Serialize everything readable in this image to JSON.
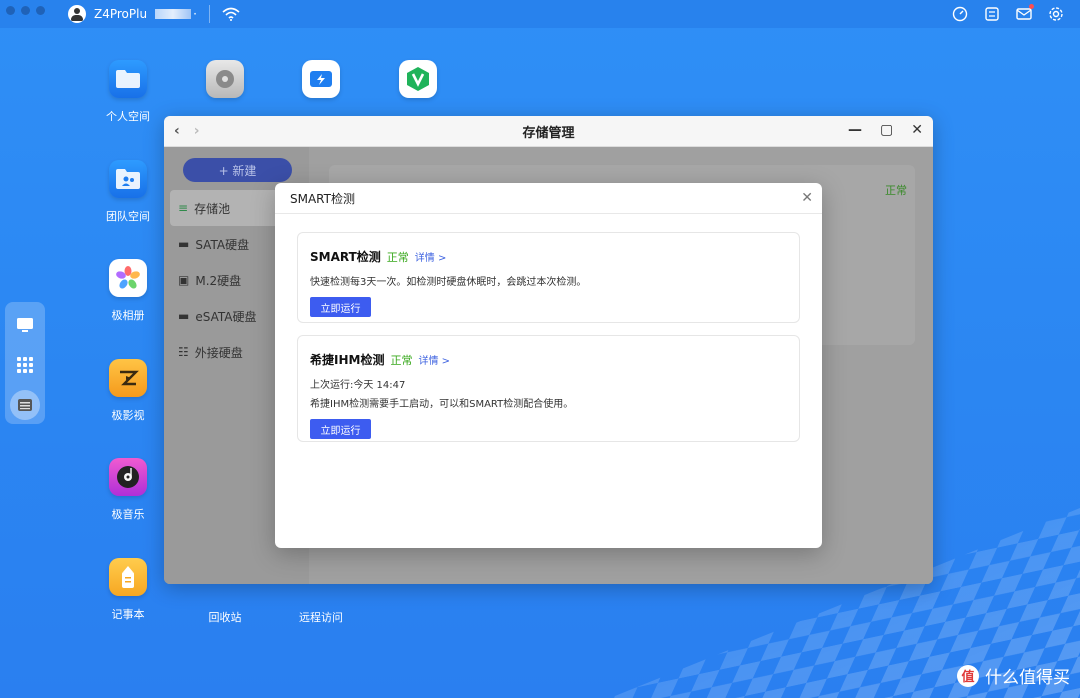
{
  "topbar": {
    "device_name": "Z4ProPlu",
    "device_suffix": "·"
  },
  "desktop": {
    "icons": [
      {
        "label": "个人空间"
      },
      {
        "label": "团队空间"
      },
      {
        "label": "极相册"
      },
      {
        "label": "极影视"
      },
      {
        "label": "极音乐"
      },
      {
        "label": "记事本"
      },
      {
        "label": "回收站"
      },
      {
        "label": "远程访问"
      }
    ]
  },
  "window": {
    "title": "存储管理",
    "new_button": "+ 新建",
    "sidebar": [
      {
        "label": "存储池"
      },
      {
        "label": "SATA硬盘"
      },
      {
        "label": "M.2硬盘"
      },
      {
        "label": "eSATA硬盘"
      },
      {
        "label": "外接硬盘"
      }
    ],
    "status_right": "正常"
  },
  "dialog": {
    "title": "SMART检测",
    "cards": [
      {
        "title": "SMART检测",
        "status": "正常",
        "more": "详情 >",
        "lines": [
          "快速检测每3天一次。如检测时硬盘休眠时，会跳过本次检测。"
        ],
        "button": "立即运行"
      },
      {
        "title": "希捷IHM检测",
        "status": "正常",
        "more": "详情 >",
        "lines": [
          "上次运行:今天 14:47",
          "希捷IHM检测需要手工启动，可以和SMART检测配合使用。"
        ],
        "button": "立即运行"
      }
    ]
  },
  "watermark": {
    "badge": "值",
    "text": "什么值得买"
  },
  "colors": {
    "desktop_bg": "#2b86f2",
    "accent": "#3d5cf0",
    "status_ok": "#38a81c",
    "link": "#3d62e0"
  }
}
